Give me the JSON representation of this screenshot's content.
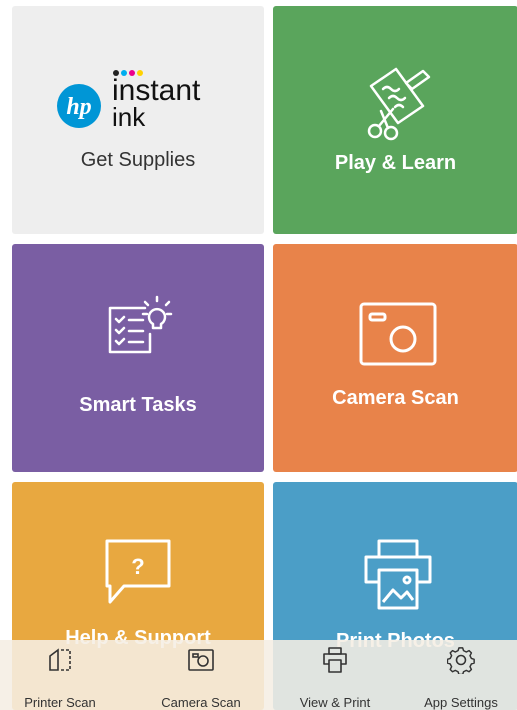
{
  "tiles": {
    "supplies": {
      "brand_hp": "hp",
      "brand_line1": "instant",
      "brand_line2": "ink",
      "label": "Get Supplies"
    },
    "play": {
      "label": "Play & Learn"
    },
    "tasks": {
      "label": "Smart Tasks"
    },
    "camera": {
      "label": "Camera Scan"
    },
    "help": {
      "label": "Help & Support"
    },
    "photos": {
      "label": "Print Photos"
    }
  },
  "bottom_nav": {
    "items": [
      {
        "label": "Printer Scan",
        "icon": "printer-scan-icon"
      },
      {
        "label": "Camera Scan",
        "icon": "camera-scan-icon"
      },
      {
        "label": "View & Print",
        "icon": "view-print-icon"
      },
      {
        "label": "App Settings",
        "icon": "settings-icon"
      }
    ]
  },
  "colors": {
    "supplies_bg": "#eeeeee",
    "play_bg": "#5aa55c",
    "tasks_bg": "#7a5ea3",
    "camera_bg": "#e8834a",
    "help_bg": "#e8a840",
    "photos_bg": "#4b9ec7",
    "hp_blue": "#0096d6"
  }
}
